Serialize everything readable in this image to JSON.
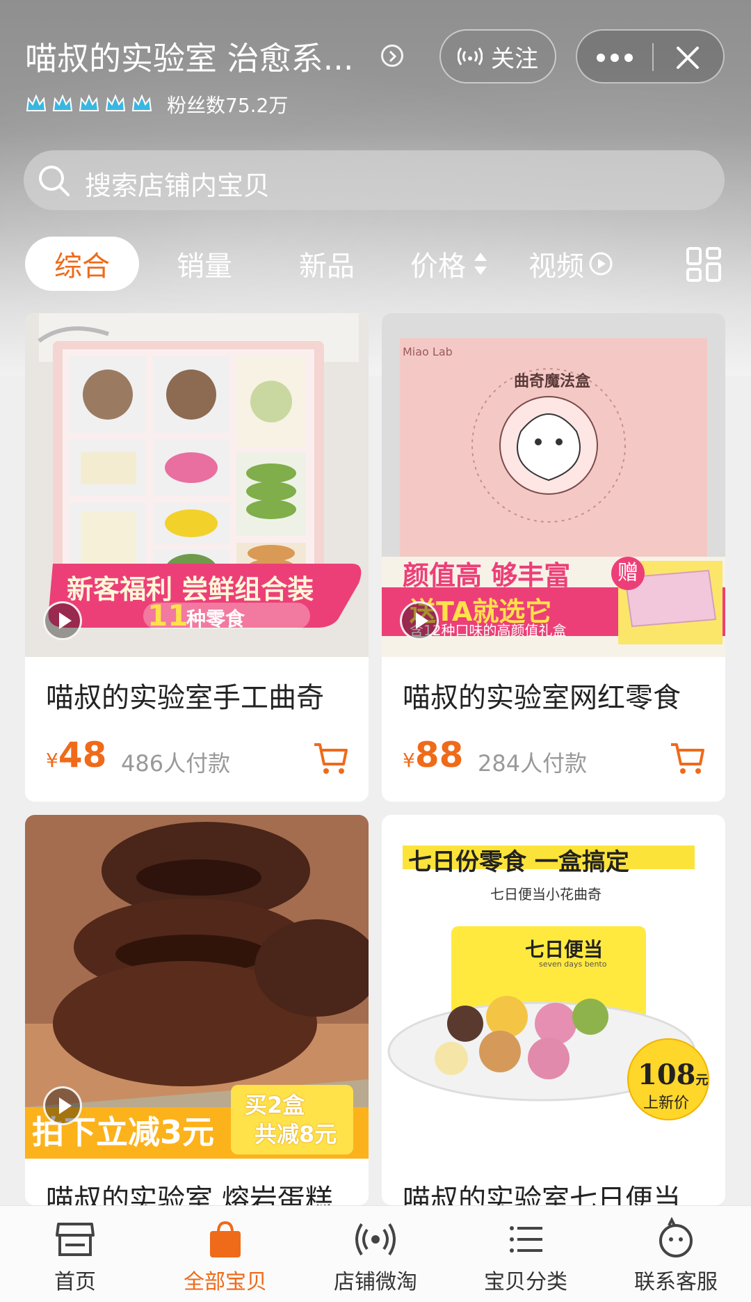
{
  "header": {
    "shop_title": "喵叔的实验室 治愈系...",
    "follow_label": "关注",
    "fans_text": "粉丝数75.2万",
    "crown_count": 5
  },
  "search": {
    "placeholder": "搜索店铺内宝贝"
  },
  "tabs": [
    {
      "label": "综合",
      "active": true
    },
    {
      "label": "销量"
    },
    {
      "label": "新品"
    },
    {
      "label": "价格"
    },
    {
      "label": "视频"
    }
  ],
  "products": [
    {
      "name": "喵叔的实验室手工曲奇",
      "currency": "¥",
      "price": "48",
      "sold": "486人付款",
      "banner_line1": "新客福利 尝鲜组合装",
      "banner_num": "11",
      "banner_line2": "种零食"
    },
    {
      "name": "喵叔的实验室网红零食",
      "currency": "¥",
      "price": "88",
      "sold": "284人付款",
      "box_title": "曲奇魔法盒",
      "box_brand": "Miao Lab",
      "banner_line1": "颜值高 够丰富",
      "banner_line2": "送TA就选它",
      "banner_gift": "赠",
      "banner_sub": "含12种口味的高颜值礼盒"
    },
    {
      "name": "喵叔的实验室 熔岩蛋糕",
      "banner_main": "拍下立减3元",
      "badge_line1": "买2盒",
      "badge_line2": "共减8元"
    },
    {
      "name": "喵叔的实验室七日便当",
      "headline": "七日份零食 一盒搞定",
      "subline": "七日便当小花曲奇",
      "box_label": "七日便当",
      "box_label_en": "seven days bento",
      "badge_price": "108",
      "badge_unit": "元",
      "badge_text": "上新价"
    }
  ],
  "bottom_nav": [
    {
      "label": "首页",
      "icon": "shop-icon"
    },
    {
      "label": "全部宝贝",
      "icon": "bag-icon",
      "active": true
    },
    {
      "label": "店铺微淘",
      "icon": "broadcast-icon"
    },
    {
      "label": "宝贝分类",
      "icon": "list-icon"
    },
    {
      "label": "联系客服",
      "icon": "chat-bubble-icon"
    }
  ],
  "colors": {
    "accent": "#ef6a19",
    "hero_gray": "#9a9a9a"
  }
}
